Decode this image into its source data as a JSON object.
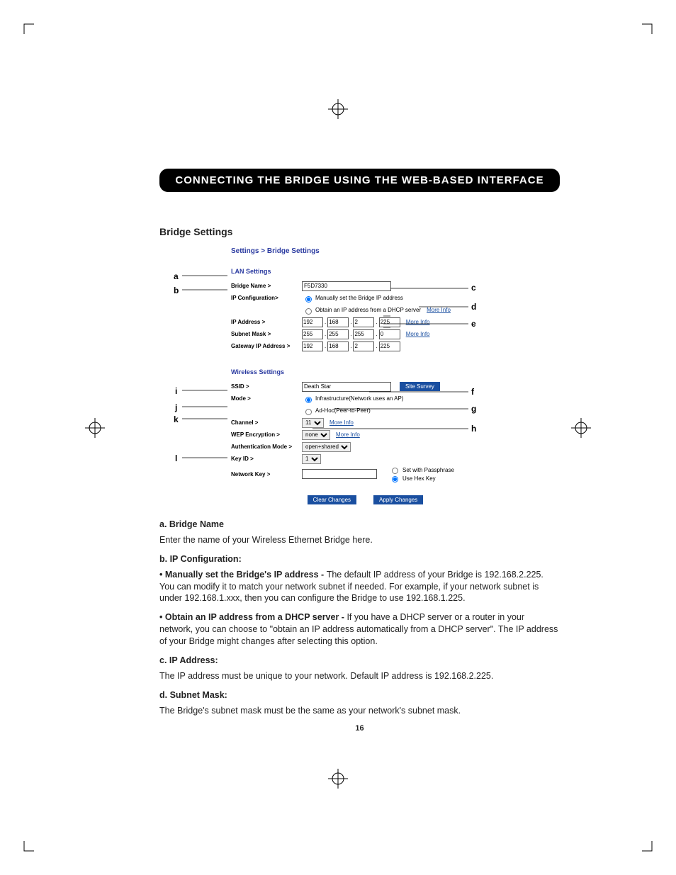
{
  "section_title": "CONNECTING THE BRIDGE USING THE WEB-BASED INTERFACE",
  "heading": "Bridge Settings",
  "page_number": "16",
  "breadcrumb": "Settings > Bridge Settings",
  "lan": {
    "group": "LAN Settings",
    "bridge_name_lbl": "Bridge Name >",
    "bridge_name_val": "F5D7330",
    "ip_config_lbl": "IP Configuration>",
    "ip_config_manual": "Manually set the Bridge IP address",
    "ip_config_dhcp": "Obtain an IP address from a DHCP server",
    "ip_addr_lbl": "IP Address >",
    "ip_addr": [
      "192",
      "168",
      "2",
      "225"
    ],
    "subnet_lbl": "Subnet Mask >",
    "subnet": [
      "255",
      "255",
      "255",
      "0"
    ],
    "gateway_lbl": "Gateway IP Address >",
    "gateway": [
      "192",
      "168",
      "2",
      "225"
    ]
  },
  "wlan": {
    "group": "Wireless Settings",
    "ssid_lbl": "SSID >",
    "ssid_val": "Death Star",
    "site_survey": "Site Survey",
    "mode_lbl": "Mode >",
    "mode_infra": "Infrastructure(Network uses an AP)",
    "mode_adhoc": "Ad-Hoc(Peer-to-Peer)",
    "channel_lbl": "Channel >",
    "channel_val": "11",
    "wep_lbl": "WEP Encryption >",
    "wep_val": "none",
    "auth_lbl": "Authentication Mode >",
    "auth_val": "open+shared",
    "keyid_lbl": "Key ID >",
    "keyid_val": "1",
    "netkey_lbl": "Network Key >",
    "set_pass": "Set with Passphrase",
    "use_hex": "Use Hex Key"
  },
  "moreinfo": "More Info",
  "buttons": {
    "clear": "Clear Changes",
    "apply": "Apply Changes"
  },
  "callouts": {
    "a": "a",
    "b": "b",
    "c": "c",
    "d": "d",
    "e": "e",
    "f": "f",
    "g": "g",
    "h": "h",
    "i": "i",
    "j": "j",
    "k": "k",
    "l": "l"
  },
  "body": {
    "a_head": "a. Bridge Name",
    "a_txt": "Enter the name of your Wireless Ethernet Bridge here.",
    "b_head": "b. IP Configuration:",
    "b_manual_lead": "Manually set the Bridge's IP address - ",
    "b_manual_txt": "The default IP address of your Bridge is 192.168.2.225. You can modify it to match your network subnet if needed. For example, if your network subnet is under 192.168.1.xxx, then you can configure the Bridge to use 192.168.1.225.",
    "b_dhcp_lead": "Obtain an IP address from a DHCP server - ",
    "b_dhcp_txt": "If you have a DHCP server or a router in your network, you can choose to \"obtain an IP address automatically from a DHCP server\". The IP address of your Bridge might changes after selecting this option.",
    "c_head": "c. IP Address:",
    "c_txt": "The IP address must be unique to your network. Default IP address is 192.168.2.225.",
    "d_head": "d. Subnet Mask:",
    "d_txt": "The Bridge's subnet mask must be the same as your network's subnet mask."
  }
}
